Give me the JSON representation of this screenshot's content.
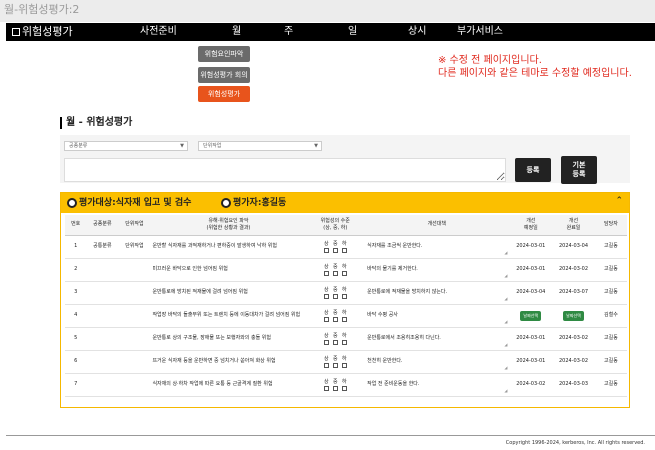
{
  "window_title": "월-위험성평가:2",
  "nav": {
    "brand": "위험성평가",
    "items": [
      "사전준비",
      "월",
      "주",
      "일",
      "상시",
      "부가서비스"
    ]
  },
  "submenu": [
    "위험요인파악",
    "위험성평가 회의",
    "위험성평가"
  ],
  "notice": {
    "line1": "※ 수정 전 페이지입니다.",
    "line2": "다른 페이지와 같은 테마로 수정할 예정입니다."
  },
  "page_title": "월 - 위험성평가",
  "filters": {
    "process_placeholder": "공종분류",
    "unit_placeholder": "단위작업",
    "register_label": "등록",
    "default_register_line1": "기본",
    "default_register_line2": "등록"
  },
  "panel": {
    "target_label": "평가대상:",
    "target_value": "식자재 입고 및 검수",
    "evaluator_label": "평가자:",
    "evaluator_value": "홍길동",
    "collapse_icon": "chevron-up-icon"
  },
  "table": {
    "headers": {
      "no": "번호",
      "process": "공종분류",
      "unit": "단위작업",
      "hazard_line1": "유해·위험요인 파악",
      "hazard_line2": "(위험한 상황과 결과)",
      "risk_line1": "위험성의 수준",
      "risk_line2": "(상, 중, 하)",
      "measure": "개선대책",
      "plan_line1": "개선",
      "plan_line2": "예정일",
      "done_line1": "개선",
      "done_line2": "완료일",
      "owner": "담당자"
    },
    "risk_levels": [
      "상",
      "중",
      "하"
    ],
    "select_label": "날짜선택",
    "rows": [
      {
        "no": "1",
        "process": "공통분류",
        "unit": "단위작업",
        "hazard": "운반할 식자재를 과적재하거나 편하중이 발생하여 낙하 위험",
        "measure": "식자재를 조금씩 운반한다.",
        "plan": "2024-03-01",
        "done": "2024-03-04",
        "owner": "고길동"
      },
      {
        "no": "2",
        "process": "",
        "unit": "",
        "hazard": "미끄러운 바닥으로 인한 넘어짐 위험",
        "measure": "바닥의 물기를 제거한다.",
        "plan": "2024-03-01",
        "done": "2024-03-02",
        "owner": "고길동"
      },
      {
        "no": "3",
        "process": "",
        "unit": "",
        "hazard": "운반통로에 방치된 적재물에 걸려 넘어짐 위험",
        "measure": "운반통로에 적재물을 방치하지 않는다.",
        "plan": "2024-03-04",
        "done": "2024-03-07",
        "owner": "고길동"
      },
      {
        "no": "4",
        "process": "",
        "unit": "",
        "hazard": "작업장 바닥의 돌출부위 또는 트렌치 등에 이동대차가 걸려 넘어짐 위험",
        "measure": "바닥 수평 공사",
        "plan": "",
        "done": "",
        "owner": "김철수"
      },
      {
        "no": "5",
        "process": "",
        "unit": "",
        "hazard": "운반통로 상의 구조물, 장애물 또는 보행자와의 충돌 위험",
        "measure": "운반통로에서 조용히조용히 다닌다.",
        "plan": "2024-03-01",
        "done": "2024-03-02",
        "owner": "고길동"
      },
      {
        "no": "6",
        "process": "",
        "unit": "",
        "hazard": "뜨거운 식자재 등을 운반하면 중 넘치거나 쏟아져 화상 위험",
        "measure": "천천히 운반한다.",
        "plan": "2024-03-01",
        "done": "2024-03-02",
        "owner": "고길동"
      },
      {
        "no": "7",
        "process": "",
        "unit": "",
        "hazard": "식자재의 상·하차 작업에 따른 요통 등 근골격계 질환 위험",
        "measure": "작업 전 준비운동을 한다.",
        "plan": "2024-03-02",
        "done": "2024-03-03",
        "owner": "고길동"
      }
    ]
  },
  "footer": "Copyright 1996-2024, kerberos, Inc. All rights reserved.",
  "colors": {
    "accent": "#fbbf00",
    "active_button": "#e8541c",
    "notice": "#e0291e",
    "date_button": "#2f8a43"
  }
}
